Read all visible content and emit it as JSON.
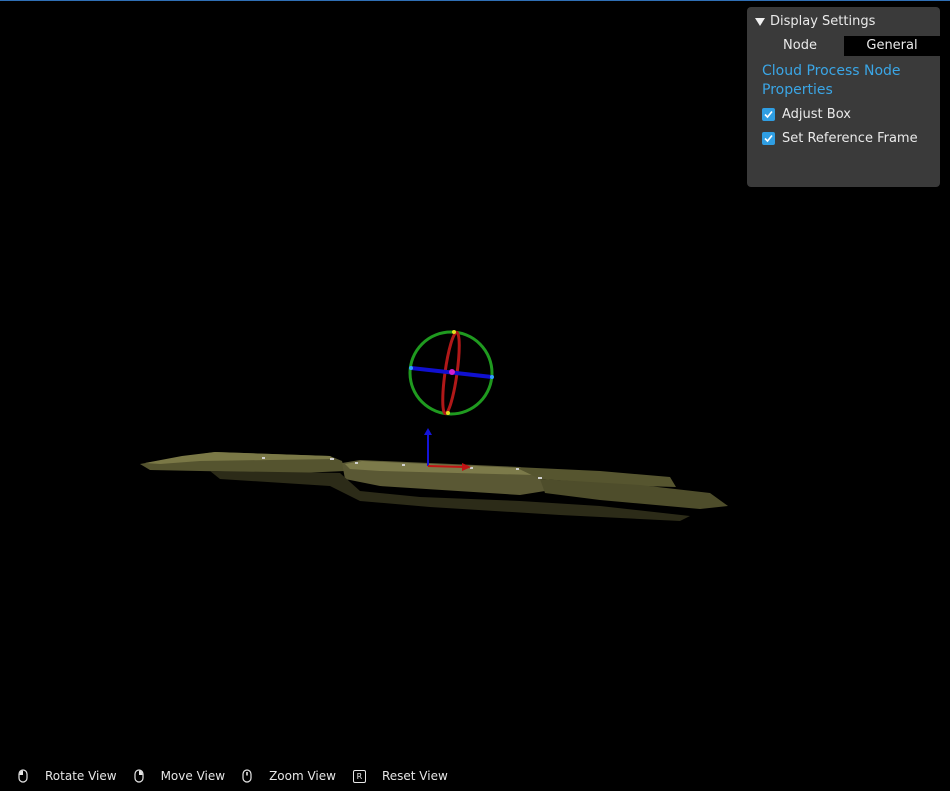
{
  "panel": {
    "title": "Display Settings",
    "tabs": [
      {
        "label": "Node"
      },
      {
        "label": "General"
      }
    ],
    "properties_link": "Cloud Process Node Properties",
    "checkboxes": [
      {
        "label": "Adjust Box",
        "checked": true
      },
      {
        "label": "Set Reference Frame",
        "checked": true
      }
    ]
  },
  "hints": [
    {
      "icon": "mouse-left-icon",
      "label": "Rotate View"
    },
    {
      "icon": "mouse-right-icon",
      "label": "Move View"
    },
    {
      "icon": "mouse-wheel-icon",
      "label": "Zoom View"
    },
    {
      "icon": "key-r-icon",
      "key": "R",
      "label": "Reset View"
    }
  ],
  "colors": {
    "background": "#000000",
    "panel": "#3a3a3a",
    "accent": "#2f9ee3",
    "link": "#3aa6e6",
    "point_cloud": "#5a5a34",
    "gizmo_ring": "#1f9a1f",
    "gizmo_axis_x": "#1010d0",
    "gizmo_axis_y": "#b01818"
  }
}
